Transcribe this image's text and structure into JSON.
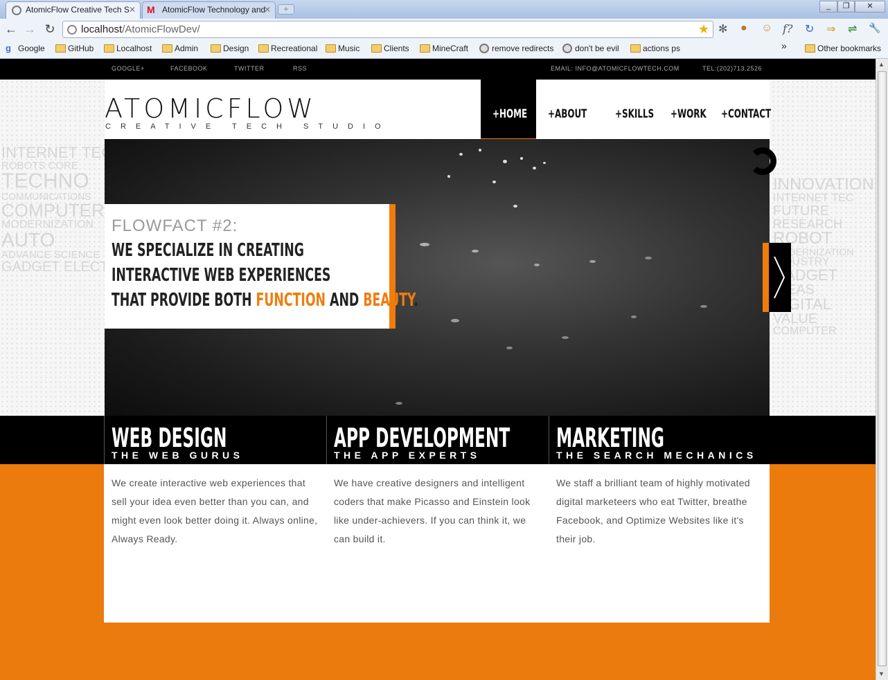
{
  "browser": {
    "tabs": [
      {
        "title": "AtomicFlow Creative Tech S"
      },
      {
        "title": "AtomicFlow Technology and"
      }
    ],
    "new_tab_symbol": "+",
    "window_buttons": [
      "_",
      "❐",
      "✕"
    ],
    "nav": {
      "back": "←",
      "forward": "→",
      "reload": "↻"
    },
    "url_host": "localhost",
    "url_path": "/AtomicFlowDev/",
    "star": "★",
    "extension_icons": [
      "gear-icon",
      "cookie-icon",
      "face-icon",
      "formula-icon",
      "refresh-arrow-icon",
      "plug-icon",
      "translate-icon",
      "wrench-icon"
    ],
    "extension_glyphs": [
      "✻",
      "●",
      "☺",
      "f?",
      "↻",
      "⇒",
      "⇌",
      "🔧"
    ],
    "bookmarks": [
      {
        "label": "Google",
        "type": "google"
      },
      {
        "label": "GitHub",
        "type": "folder"
      },
      {
        "label": "Localhost",
        "type": "folder"
      },
      {
        "label": "Admin",
        "type": "folder"
      },
      {
        "label": "Design",
        "type": "folder"
      },
      {
        "label": "Recreational",
        "type": "folder"
      },
      {
        "label": "Music",
        "type": "folder"
      },
      {
        "label": "Clients",
        "type": "folder"
      },
      {
        "label": "MineCraft",
        "type": "folder"
      },
      {
        "label": "remove redirects",
        "type": "globe"
      },
      {
        "label": "don't be evil",
        "type": "globe"
      },
      {
        "label": "actions ps",
        "type": "folder"
      }
    ],
    "overflow": "»",
    "other_bookmarks": "Other bookmarks"
  },
  "site": {
    "topbar": {
      "social": [
        "GOOGLE+",
        "FACEBOOK",
        "TWITTER",
        "RSS"
      ],
      "email": "EMAIL: INFO@ATOMICFLOWTECH.COM",
      "phone": "TEL:(202)713.2526"
    },
    "logo": "ATOMICFLOW",
    "tagline": "CREATIVE TECH STUDIO",
    "menu": [
      "+HOME",
      "+ABOUT",
      "+SKILLS",
      "+WORK",
      "+CONTACT"
    ],
    "active_menu": "+HOME",
    "fact": {
      "number": "FLOWFACT #2:",
      "line1": "WE SPECIALIZE IN CREATING",
      "line2": "INTERACTIVE WEB EXPERIENCES",
      "line3_pre": "THAT PROVIDE BOTH ",
      "highlight1": "FUNCTION",
      "line3_mid": " AND ",
      "highlight2": "BEAUTY",
      "line3_end": "."
    },
    "columns": [
      {
        "title": "WEB DESIGN",
        "subtitle": "THE WEB GURUS",
        "body": "We create interactive web experiences that sell your idea even better than you can, and might even look better doing it. Always online, Always Ready."
      },
      {
        "title": "APP DEVELOPMENT",
        "subtitle": "THE APP EXPERTS",
        "body": "We have creative designers and intelligent coders that make Picasso and Einstein look like under-achievers. If you can think it, we can build it."
      },
      {
        "title": "MARKETING",
        "subtitle": "THE SEARCH MECHANICS",
        "body": "We staff a brilliant team of highly motivated digital marketeers who eat Twitter, breathe Facebook, and Optimize Websites like it's their job."
      }
    ],
    "colors": {
      "accent": "#ef7d0c",
      "dark": "#000000",
      "orange_band": "#ec7b0d"
    }
  }
}
